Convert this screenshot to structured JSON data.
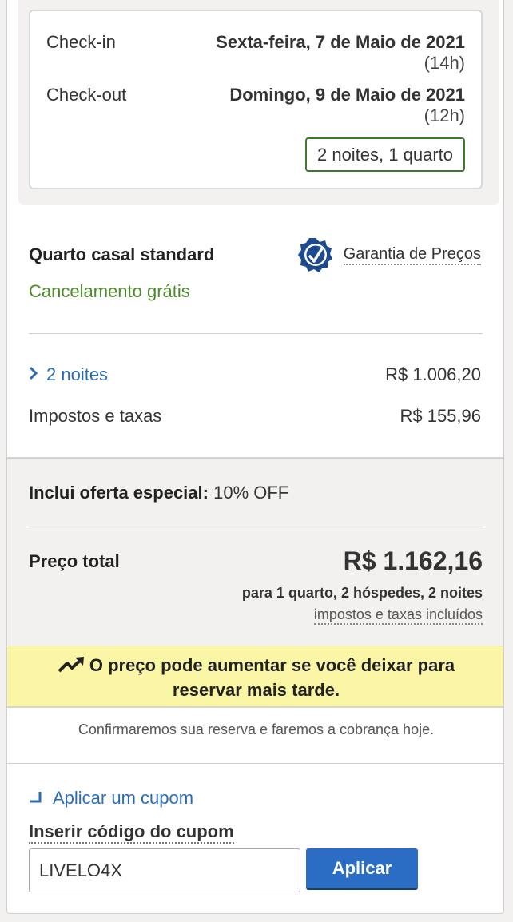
{
  "stay": {
    "checkin_label": "Check-in",
    "checkin_date": "Sexta-feira, 7 de Maio de 2021",
    "checkin_time": "(14h)",
    "checkout_label": "Check-out",
    "checkout_date": "Domingo, 9 de Maio de 2021",
    "checkout_time": "(12h)",
    "summary": "2 noites, 1 quarto"
  },
  "room": {
    "name": "Quarto casal standard",
    "cancellation": "Cancelamento grátis",
    "guarantee": "Garantia de Preços"
  },
  "price": {
    "nights_label": "2 noites",
    "nights_amount": "R$ 1.006,20",
    "taxes_label": "Impostos e taxas",
    "taxes_amount": "R$ 155,96",
    "offer_label": "Inclui oferta especial:",
    "offer_value": "10% OFF",
    "total_label": "Preço total",
    "total_value": "R$ 1.162,16",
    "total_details": "para 1 quarto, 2 hóspedes, 2 noites",
    "total_included": "impostos e taxas incluídos"
  },
  "alert": {
    "line1": "O preço pode aumentar se você deixar para",
    "line2": "reservar mais tarde."
  },
  "confirm_text": "Confirmaremos sua reserva e faremos a cobrança hoje.",
  "coupon": {
    "link": "Aplicar um cupom",
    "label": "Inserir código do cupom",
    "value": "LIVELO4X",
    "button": "Aplicar"
  },
  "colors": {
    "link_blue": "#2a6db5",
    "green": "#4a8a2a",
    "alert_yellow": "#fbf6a5",
    "button_blue": "#2b6cc4"
  },
  "icons": [
    "chevron-right-icon",
    "price-guarantee-badge-icon",
    "trending-up-icon",
    "return-arrow-icon"
  ]
}
